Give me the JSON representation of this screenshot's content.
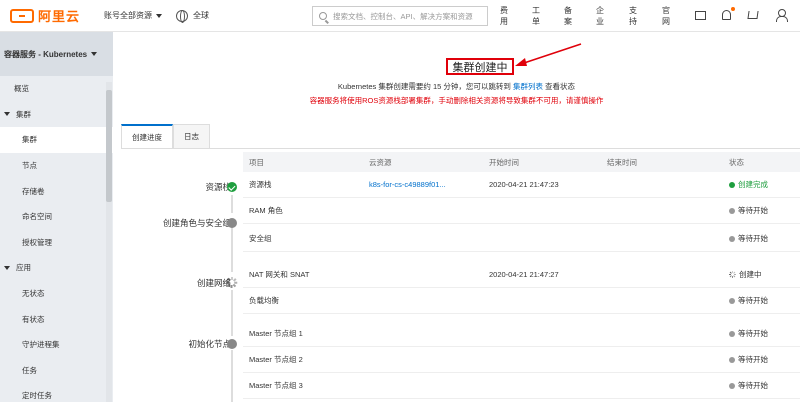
{
  "topbar": {
    "logo_text": "阿里云",
    "resource_select": "账号全部资源",
    "region": "全球",
    "search_placeholder": "搜索文档、控制台、API、解决方案和资源",
    "nav": [
      "费用",
      "工单",
      "备案",
      "企业",
      "支持",
      "官网"
    ],
    "accent_color": "#ff6a00"
  },
  "sidebar": {
    "title": "容器服务 - Kubernetes",
    "items": [
      {
        "label": "概览",
        "kind": "top"
      },
      {
        "label": "集群",
        "kind": "group"
      },
      {
        "label": "集群",
        "kind": "sub",
        "active": true
      },
      {
        "label": "节点",
        "kind": "sub"
      },
      {
        "label": "存储卷",
        "kind": "sub"
      },
      {
        "label": "命名空间",
        "kind": "sub"
      },
      {
        "label": "授权管理",
        "kind": "sub"
      },
      {
        "label": "应用",
        "kind": "group"
      },
      {
        "label": "无状态",
        "kind": "sub"
      },
      {
        "label": "有状态",
        "kind": "sub"
      },
      {
        "label": "守护进程集",
        "kind": "sub"
      },
      {
        "label": "任务",
        "kind": "sub"
      },
      {
        "label": "定时任务",
        "kind": "sub"
      }
    ]
  },
  "main": {
    "title": "集群创建中",
    "info_pre": "Kubernetes 集群创建需要约 15 分钟，您可以跳转到 ",
    "info_link": "集群列表",
    "info_post": " 查看状态",
    "warning": "容器服务将使用ROS资源栈部署集群，手动删除相关资源将导致集群不可用，请谨慎操作",
    "tabs": [
      "创建进度",
      "日志"
    ],
    "columns": [
      "项目",
      "云资源",
      "开始时间",
      "结束时间",
      "状态"
    ],
    "stages": [
      {
        "label": "资源栈",
        "status": "success"
      },
      {
        "label": "创建角色与安全组",
        "status": "waiting"
      },
      {
        "label": "创建网络",
        "status": "running"
      },
      {
        "label": "初始化节点",
        "status": "waiting"
      }
    ],
    "rows": [
      {
        "item": "资源栈",
        "resource": "k8s-for-cs-c49889f01...",
        "start": "2020-04-21 21:47:23",
        "end": "",
        "status": "创建完成",
        "state": "ok"
      },
      {
        "item": "RAM 角色",
        "resource": "",
        "start": "",
        "end": "",
        "status": "等待开始",
        "state": "wait"
      },
      {
        "item": "安全组",
        "resource": "",
        "start": "",
        "end": "",
        "status": "等待开始",
        "state": "wait"
      },
      {
        "item": "NAT 网关和 SNAT",
        "resource": "",
        "start": "2020-04-21 21:47:27",
        "end": "",
        "status": "创建中",
        "state": "run"
      },
      {
        "item": "负载均衡",
        "resource": "",
        "start": "",
        "end": "",
        "status": "等待开始",
        "state": "wait"
      },
      {
        "item": "Master 节点组 1",
        "resource": "",
        "start": "",
        "end": "",
        "status": "等待开始",
        "state": "wait"
      },
      {
        "item": "Master 节点组 2",
        "resource": "",
        "start": "",
        "end": "",
        "status": "等待开始",
        "state": "wait"
      },
      {
        "item": "Master 节点组 3",
        "resource": "",
        "start": "",
        "end": "",
        "status": "等待开始",
        "state": "wait"
      }
    ],
    "success_color": "#1e9e3e",
    "warning_color": "#e0000a",
    "link_color": "#0070cc"
  }
}
